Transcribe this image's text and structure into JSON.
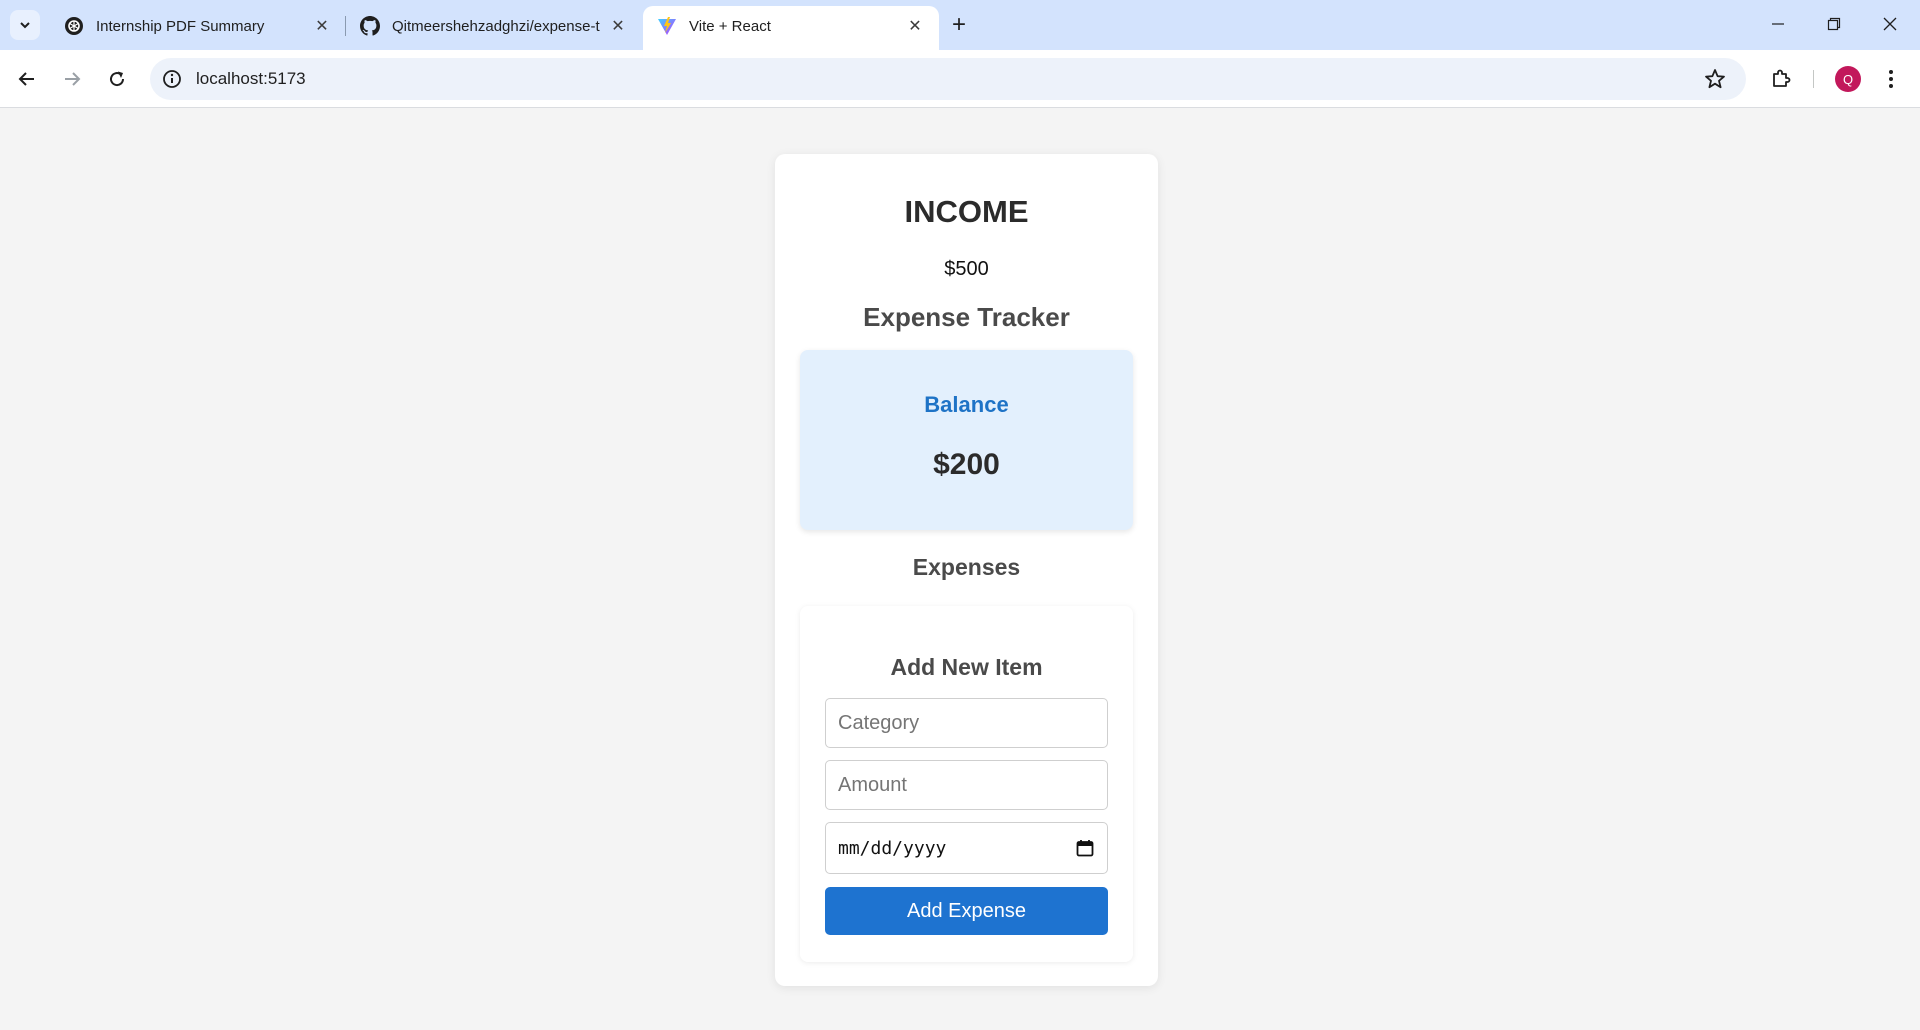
{
  "browser": {
    "tabs": [
      {
        "label": "Internship PDF Summary",
        "icon": "openai-icon",
        "active": false
      },
      {
        "label": "Qitmeershehzadghzi/expense-t",
        "icon": "github-icon",
        "active": false
      },
      {
        "label": "Vite + React",
        "icon": "vite-icon",
        "active": true
      }
    ],
    "new_tab_label": "+",
    "url": "localhost:5173",
    "profile_initial": "Q",
    "profile_color": "#c2185b"
  },
  "app": {
    "income_title": "INCOME",
    "income_value": "$500",
    "tracker_title": "Expense Tracker",
    "balance_label": "Balance",
    "balance_value": "$200",
    "expenses_title": "Expenses",
    "form": {
      "title": "Add New Item",
      "category_placeholder": "Category",
      "amount_placeholder": "Amount",
      "date_placeholder": "mm/dd/yyyy",
      "submit_label": "Add Expense"
    },
    "colors": {
      "accent": "#1e73d0",
      "balance_bg": "#e3f0fd",
      "balance_label": "#1e73c6",
      "page_bg": "#f4f4f4"
    }
  }
}
